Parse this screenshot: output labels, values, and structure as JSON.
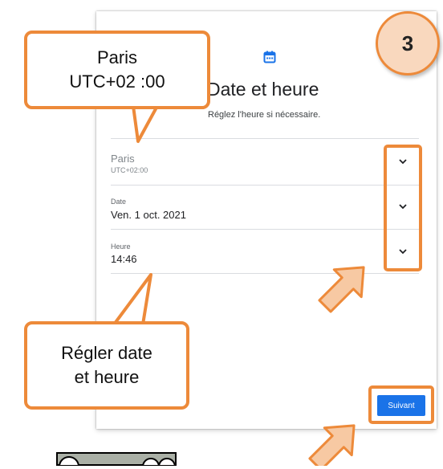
{
  "screen": {
    "title": "Date et heure",
    "subtitle": "Réglez l'heure si nécessaire.",
    "timezone": {
      "city": "Paris",
      "offset": "UTC+02:00"
    },
    "date": {
      "label": "Date",
      "value": "Ven. 1 oct. 2021"
    },
    "time": {
      "label": "Heure",
      "value": "14:46"
    },
    "next_button": "Suivant"
  },
  "annotations": {
    "callout_timezone": {
      "line1": "Paris",
      "line2": "UTC+02 :00"
    },
    "callout_adjust": {
      "line1": "Régler date",
      "line2": "et heure"
    },
    "step_number": "3"
  },
  "colors": {
    "accent": "#1a73e8",
    "highlight": "#ed8a3a",
    "badge_fill": "#f9d8be"
  },
  "icons": [
    "calendar-icon",
    "chevron-down-icon",
    "arrow-icon",
    "license-badge"
  ]
}
